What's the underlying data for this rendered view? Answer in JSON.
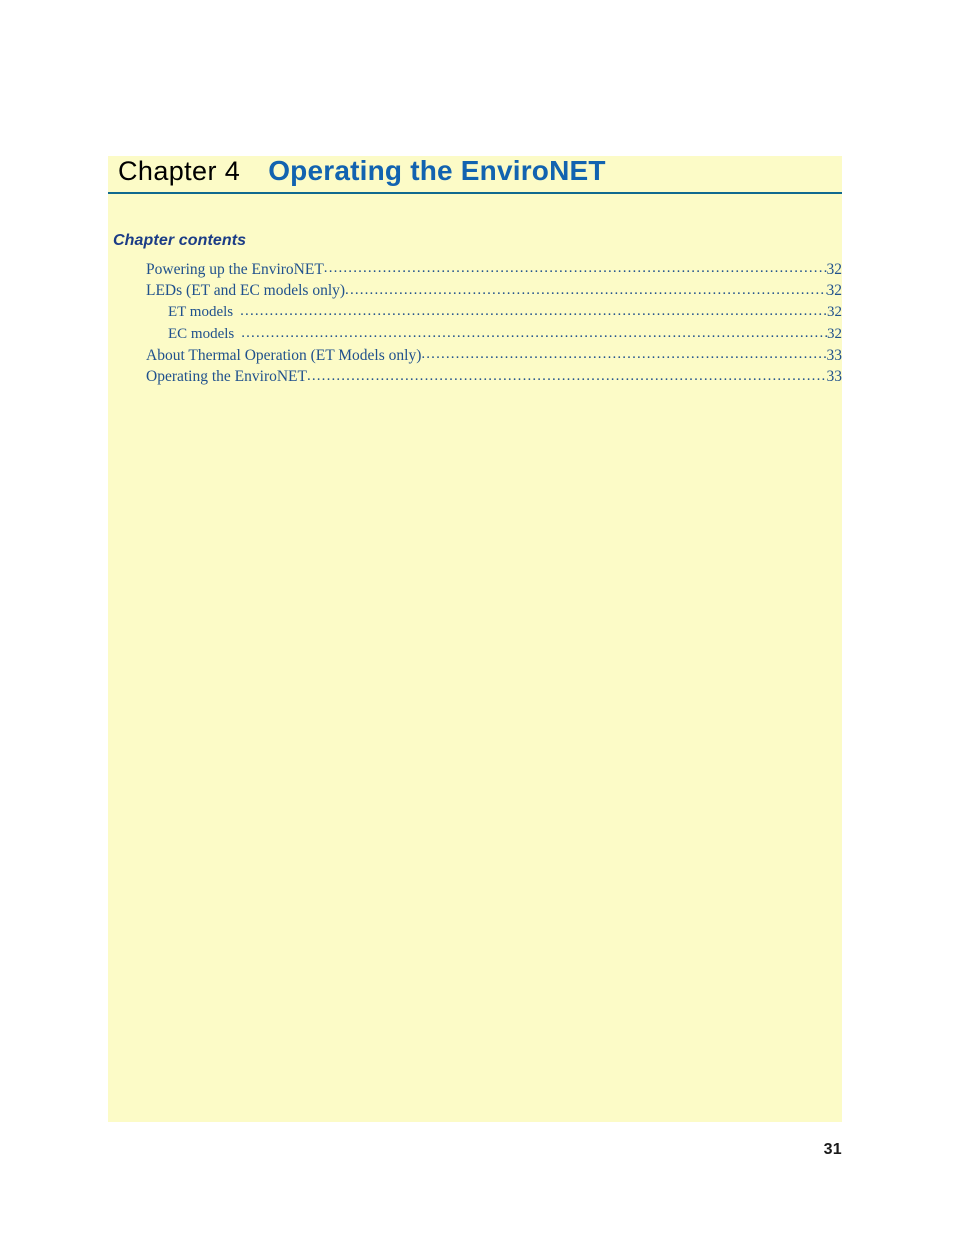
{
  "document": {
    "page_number": "31",
    "panel_color": "#fcfbc7",
    "rule_color": "#10698f",
    "accent_blue": "#1263b0",
    "toc_text_color": "#20518d",
    "heading_color": "#1b3c86"
  },
  "chapter": {
    "label": "Chapter 4",
    "title": "Operating the EnviroNET"
  },
  "contents": {
    "heading": "Chapter contents",
    "entries": [
      {
        "title": "Powering up the EnviroNET",
        "page": "32",
        "level": 1
      },
      {
        "title": "LEDs (ET and EC models only)",
        "page": "32",
        "level": 1
      },
      {
        "title": "ET models",
        "page": "32",
        "level": 2
      },
      {
        "title": "EC models",
        "page": "32",
        "level": 2
      },
      {
        "title": "About Thermal Operation (ET Models only)",
        "page": "33",
        "level": 1
      },
      {
        "title": "Operating the EnviroNET",
        "page": "33",
        "level": 1
      }
    ]
  }
}
